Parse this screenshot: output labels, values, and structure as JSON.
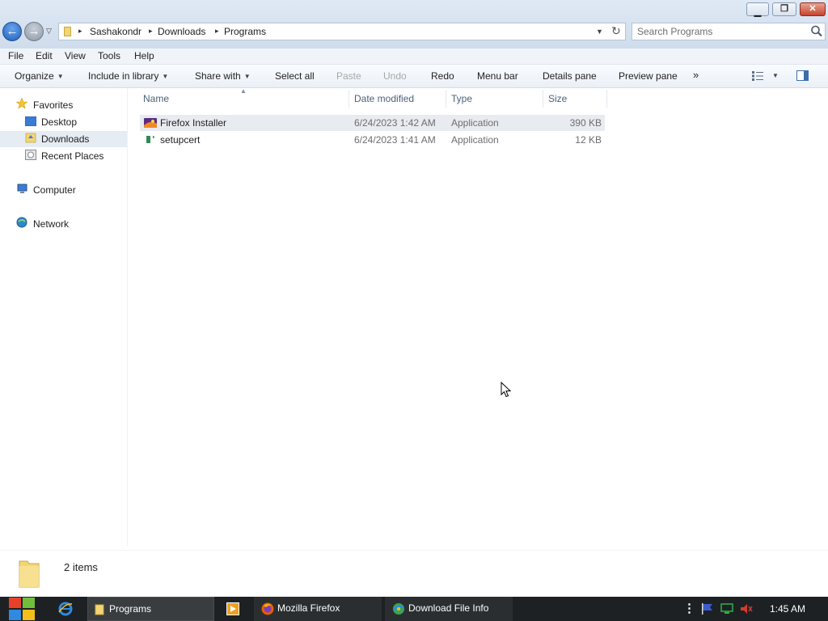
{
  "window": {
    "minimize_glyph": "▁",
    "maximize_glyph": "❐",
    "close_glyph": "✕"
  },
  "nav": {
    "back_glyph": "←",
    "forward_glyph": "→",
    "recent_glyph": "▽"
  },
  "address": {
    "breadcrumbs": [
      "Sashakondr",
      "Downloads",
      "Programs"
    ],
    "separator": "▸",
    "dropdown_glyph": "▼",
    "refresh_glyph": "↻"
  },
  "search": {
    "placeholder": "Search Programs"
  },
  "menu": [
    "File",
    "Edit",
    "View",
    "Tools",
    "Help"
  ],
  "toolbar": {
    "organize": "Organize",
    "include_in_library": "Include in library",
    "share_with": "Share with",
    "select_all": "Select all",
    "paste": "Paste",
    "undo": "Undo",
    "redo": "Redo",
    "menu_bar": "Menu bar",
    "details_pane": "Details pane",
    "preview_pane": "Preview pane",
    "more": "»",
    "caret": "▼"
  },
  "sidebar": {
    "favorites": "Favorites",
    "items": [
      "Desktop",
      "Downloads",
      "Recent Places"
    ],
    "computer": "Computer",
    "network": "Network"
  },
  "columns": [
    "Name",
    "Date modified",
    "Type",
    "Size"
  ],
  "files": [
    {
      "name": "Firefox Installer",
      "date": "6/24/2023 1:42 AM",
      "type": "Application",
      "size": "390 KB",
      "selected": true
    },
    {
      "name": "setupcert",
      "date": "6/24/2023 1:41 AM",
      "type": "Application",
      "size": "12 KB",
      "selected": false
    }
  ],
  "status": {
    "items_count": "2 items"
  },
  "taskbar": {
    "programs": "Programs",
    "firefox": "Mozilla Firefox",
    "download_info": "Download File Info",
    "clock": "1:45 AM",
    "tray_more": "⋮"
  },
  "colors": {
    "accent_blue": "#1f5fb8",
    "close_red": "#c7432c",
    "taskbar": "#1e2123",
    "selected_row": "#e8ebf0"
  }
}
